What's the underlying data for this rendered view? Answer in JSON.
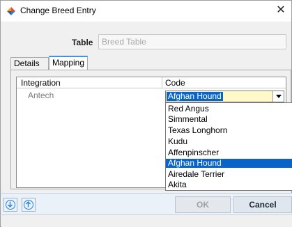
{
  "window": {
    "title": "Change Breed Entry",
    "close_glyph": "✕"
  },
  "form": {
    "table_label": "Table",
    "table_value": "Breed Table"
  },
  "tabs": [
    {
      "label": "Details",
      "active": false
    },
    {
      "label": "Mapping",
      "active": true
    }
  ],
  "grid": {
    "columns": [
      "Integration",
      "Code"
    ],
    "rows": [
      {
        "integration": "Antech",
        "code": "Afghan Hound"
      }
    ]
  },
  "dropdown": {
    "options": [
      "Red Angus",
      "Simmental",
      "Texas Longhorn",
      "Kudu",
      "Affenpinscher",
      "Afghan Hound",
      "Airedale Terrier",
      "Akita"
    ],
    "selected": "Afghan Hound"
  },
  "footer": {
    "move_down_icon": "arrow-down-circle-icon",
    "move_up_icon": "arrow-up-circle-icon",
    "ok_label": "OK",
    "cancel_label": "Cancel"
  },
  "colors": {
    "selection": "#0a64c8",
    "select_bg": "#fff8c8",
    "footer_bg": "#ebf1f8",
    "icon_blue": "#2a7fd4"
  }
}
